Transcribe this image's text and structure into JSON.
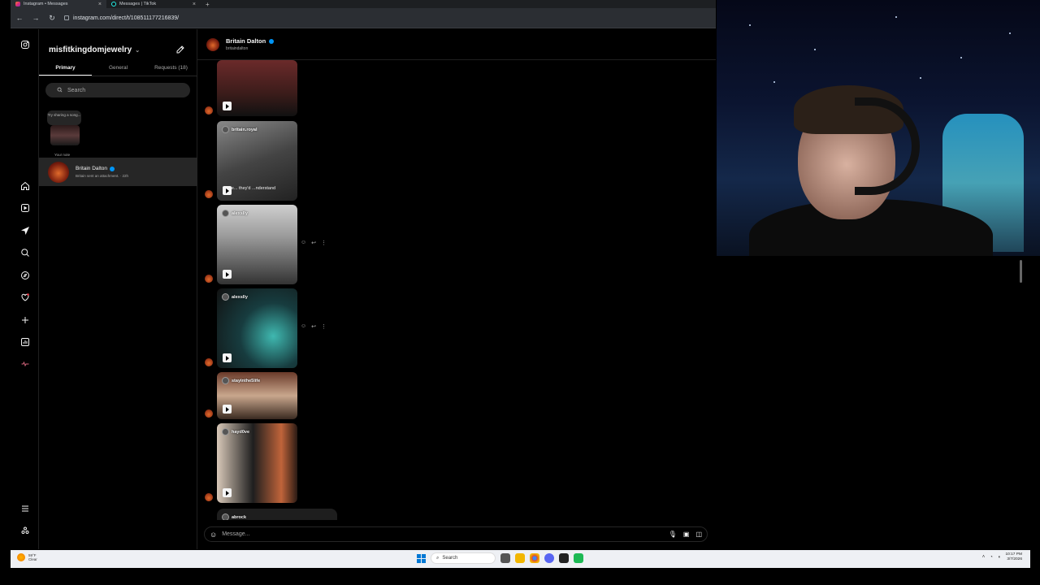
{
  "browser": {
    "tabs": [
      {
        "label": "Instagram • Messages",
        "active": true
      },
      {
        "label": "Messages | TikTok",
        "active": false
      }
    ],
    "url": "instagram.com/direct/t/108511177216839/"
  },
  "panel": {
    "account": "misfitkingdomjewelry",
    "tabs": [
      "Primary",
      "General",
      "Requests (18)"
    ],
    "search_placeholder": "Search",
    "note_text": "Try sharing a song...",
    "note_label": "Your note",
    "thread": {
      "name": "Britain Dalton",
      "preview": "Britain sent an attachment. · 22h"
    }
  },
  "chat": {
    "name": "Britain Dalton",
    "handle": "britaindalton",
    "messages": [
      {
        "handle": "",
        "overlay": ""
      },
      {
        "handle": "britain.royal",
        "overlay": "she... they'd ...nderstand"
      },
      {
        "handle": "alexslly",
        "overlay": ""
      },
      {
        "handle": "alexslly",
        "overlay": ""
      },
      {
        "handle": "stayinthe5life",
        "overlay": ""
      },
      {
        "handle": "hayd0ve",
        "overlay": ""
      },
      {
        "handle": "abrock",
        "overlay": ""
      }
    ],
    "composer_placeholder": "Message..."
  },
  "taskbar": {
    "weather_temp": "59°F",
    "weather_desc": "Clear",
    "search_label": "Search",
    "time": "10:17 PM",
    "date": "3/7/2026"
  },
  "colors": {
    "accent_blue": "#0095f6",
    "ig_bg": "#000000",
    "surface": "#262626"
  }
}
